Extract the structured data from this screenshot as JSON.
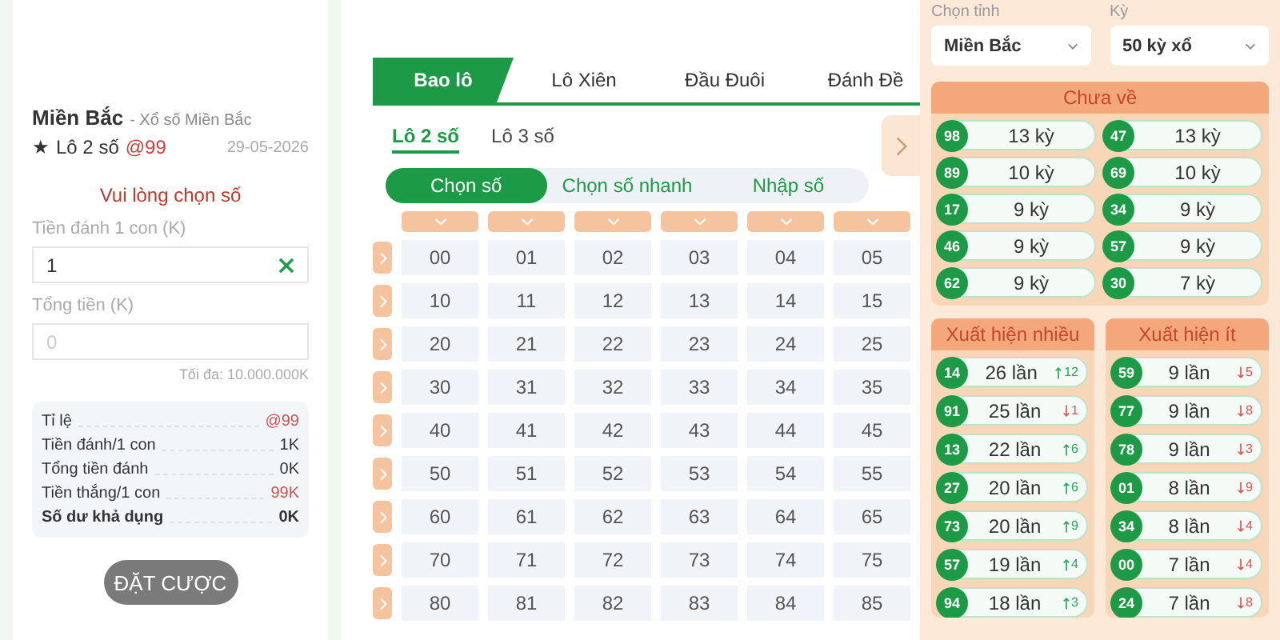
{
  "bet_slip": {
    "region": "Miền Bắc",
    "subtitle": "- Xổ số Miền Bắc",
    "star": "★",
    "bet_type": "Lô 2 số",
    "odds": "@99",
    "date": "29-05-2026",
    "prompt": "Vui lòng chọn số",
    "stake_label": "Tiền đánh 1 con (K)",
    "stake_value": "1",
    "total_label": "Tổng tiền (K)",
    "total_placeholder": "0",
    "max_note": "Tối đa: 10.000.000K",
    "summary": [
      {
        "label": "Tỉ lệ",
        "value": "@99",
        "kind": "accent"
      },
      {
        "label": "Tiền đánh/1 con",
        "value": "1K",
        "kind": "plain"
      },
      {
        "label": "Tổng tiền đánh",
        "value": "0K",
        "kind": "plain"
      },
      {
        "label": "Tiền thắng/1 con",
        "value": "99K",
        "kind": "accent"
      },
      {
        "label": "Số dư khả dụng",
        "value": "0K",
        "kind": "total"
      }
    ],
    "submit": {
      "label": "ĐẶT CƯỢC",
      "disabled": true
    }
  },
  "tabs": [
    {
      "label": "Bao lô",
      "selected": true
    },
    {
      "label": "Lô Xiên",
      "selected": false
    },
    {
      "label": "Đầu Đuôi",
      "selected": false
    },
    {
      "label": "Đánh Đề",
      "selected": false
    }
  ],
  "subtabs": [
    {
      "label": "Lô 2 số",
      "selected": true
    },
    {
      "label": "Lô 3 số",
      "selected": false
    }
  ],
  "modes": [
    {
      "label": "Chọn số",
      "selected": true
    },
    {
      "label": "Chọn số nhanh",
      "selected": false
    },
    {
      "label": "Nhập số",
      "selected": false
    }
  ],
  "grid": [
    [
      "00",
      "01",
      "02",
      "03",
      "04",
      "05"
    ],
    [
      "10",
      "11",
      "12",
      "13",
      "14",
      "15"
    ],
    [
      "20",
      "21",
      "22",
      "23",
      "24",
      "25"
    ],
    [
      "30",
      "31",
      "32",
      "33",
      "34",
      "35"
    ],
    [
      "40",
      "41",
      "42",
      "43",
      "44",
      "45"
    ],
    [
      "50",
      "51",
      "52",
      "53",
      "54",
      "55"
    ],
    [
      "60",
      "61",
      "62",
      "63",
      "64",
      "65"
    ],
    [
      "70",
      "71",
      "72",
      "73",
      "74",
      "75"
    ],
    [
      "80",
      "81",
      "82",
      "83",
      "84",
      "85"
    ]
  ],
  "stats": {
    "province": {
      "label": "Chọn tỉnh",
      "value": "Miền Bắc"
    },
    "period": {
      "label": "Kỳ",
      "value": "50 kỳ xổ"
    },
    "not_returned": {
      "title": "Chưa về",
      "items": [
        {
          "number": "98",
          "count": "13 kỳ"
        },
        {
          "number": "47",
          "count": "13 kỳ"
        },
        {
          "number": "89",
          "count": "10 kỳ"
        },
        {
          "number": "69",
          "count": "10 kỳ"
        },
        {
          "number": "17",
          "count": "9 kỳ"
        },
        {
          "number": "34",
          "count": "9 kỳ"
        },
        {
          "number": "46",
          "count": "9 kỳ"
        },
        {
          "number": "57",
          "count": "9 kỳ"
        },
        {
          "number": "62",
          "count": "9 kỳ"
        },
        {
          "number": "30",
          "count": "7 kỳ"
        }
      ]
    },
    "frequent": {
      "title": "Xuất hiện nhiều",
      "items": [
        {
          "number": "14",
          "count": "26 lần",
          "trend": "12",
          "rising": true
        },
        {
          "number": "91",
          "count": "25 lần",
          "trend": "1",
          "rising": false
        },
        {
          "number": "13",
          "count": "22 lần",
          "trend": "6",
          "rising": true
        },
        {
          "number": "27",
          "count": "20 lần",
          "trend": "6",
          "rising": true
        },
        {
          "number": "73",
          "count": "20 lần",
          "trend": "9",
          "rising": true
        },
        {
          "number": "57",
          "count": "19 lần",
          "trend": "4",
          "rising": true
        },
        {
          "number": "94",
          "count": "18 lần",
          "trend": "3",
          "rising": true
        }
      ]
    },
    "rare": {
      "title": "Xuất hiện ít",
      "items": [
        {
          "number": "59",
          "count": "9 lần",
          "trend": "5",
          "rising": false
        },
        {
          "number": "77",
          "count": "9 lần",
          "trend": "8",
          "rising": false
        },
        {
          "number": "78",
          "count": "9 lần",
          "trend": "3",
          "rising": false
        },
        {
          "number": "01",
          "count": "8 lần",
          "trend": "9",
          "rising": false
        },
        {
          "number": "34",
          "count": "8 lần",
          "trend": "4",
          "rising": false
        },
        {
          "number": "00",
          "count": "7 lần",
          "trend": "4",
          "rising": false
        },
        {
          "number": "24",
          "count": "7 lần",
          "trend": "8",
          "rising": false
        }
      ]
    }
  }
}
